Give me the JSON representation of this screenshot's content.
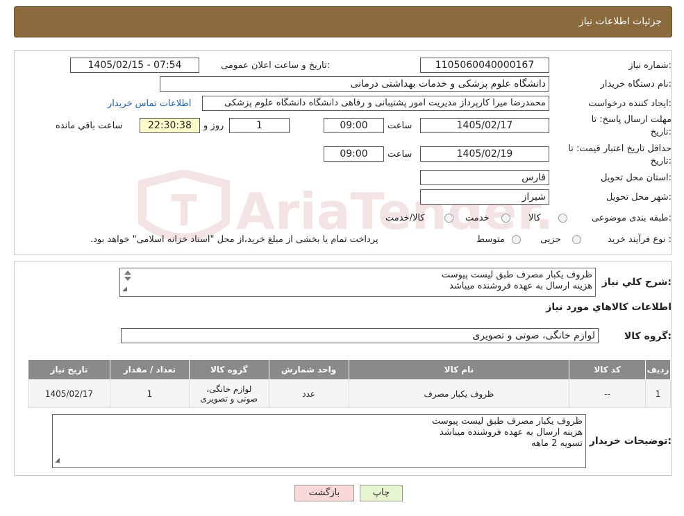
{
  "header": {
    "title": "جزئیات اطلاعات نیاز"
  },
  "fields": {
    "need_number_label": "شماره نیاز:",
    "need_number": "1105060040000167",
    "announce_label": "تاریخ و ساعت اعلان عمومی:",
    "announce_value": "1405/02/15 - 07:54",
    "buyer_org_label": "نام دستگاه خریدار:",
    "buyer_org": "دانشگاه علوم پزشکی و خدمات بهداشتی درمانی",
    "creator_label": "ایجاد کننده درخواست:",
    "creator": "محمدرضا میرا کارپرداز مدیریت امور پشتیبانی و رفاهی دانشگاه دانشگاه علوم پزشکی",
    "contact_link": "اطلاعات تماس خریدار",
    "deadline_label_1": "مهلت ارسال پاسخ: تا",
    "deadline_label_2": "تاریخ:",
    "deadline_date": "1405/02/17",
    "time_label": "ساعت",
    "deadline_time": "09:00",
    "days_value": "1",
    "days_label": "روز و",
    "remaining_time": "22:30:38",
    "remaining_label": "ساعت باقي مانده",
    "validity_label_1": "حداقل تاریخ اعتبار قیمت: تا",
    "validity_label_2": "تاریخ:",
    "validity_date": "1405/02/19",
    "validity_time_label": "ساعت",
    "validity_time": "09:00",
    "province_label": "استان محل تحویل:",
    "province": "فارس",
    "city_label": "شهر محل تحویل:",
    "city": "شیراز",
    "category_label": "طبقه بندی موضوعی:",
    "category_options": [
      "کالا",
      "خدمت",
      "کالا/خدمت"
    ],
    "process_label": "نوع فرآیند خرید :",
    "process_options": [
      "جزیی",
      "متوسط"
    ],
    "process_note": "پرداخت تمام یا بخشی از مبلغ خرید،از محل \"اسناد خزانه اسلامی\" خواهد بود."
  },
  "description": {
    "label": "شرح کلي نياز:",
    "lines": [
      "ظروف یکبار مصرف طبق لیست پیوست",
      "هزینه ارسال به عهده فروشنده میباشد"
    ]
  },
  "goods": {
    "section_title": "اطلاعات کالاهاي مورد نياز",
    "group_label": "گروه کالا:",
    "group_value": "لوازم خانگی، صوتی و تصویری"
  },
  "table": {
    "headers": [
      "رديف",
      "کد کالا",
      "نام کالا",
      "واحد شمارش",
      "گروه کالا",
      "تعداد / مقدار",
      "تاريخ نياز"
    ],
    "rows": [
      {
        "row": "1",
        "code": "--",
        "name": "ظروف یکبار مصرف",
        "unit": "عدد",
        "group_1": "لوازم خانگی،",
        "group_2": "صوتی و تصویری",
        "qty": "1",
        "date": "1405/02/17"
      }
    ]
  },
  "buyer_notes": {
    "label": "توضیحات خریدار:",
    "lines": [
      "ظروف یکبار مصرف طبق لیست پیوست",
      "هزینه ارسال به عهده فروشنده میباشد",
      "تسویه 2 ماهه"
    ]
  },
  "buttons": {
    "print": "چاپ",
    "back": "بازگشت"
  },
  "watermark": {
    "text": "AriaTender.neT"
  },
  "colors": {
    "header_bg": "#8b6a3e",
    "table_header_bg": "#8a8a8a",
    "link": "#1a5fb4",
    "print_btn_bg": "#e6f5d0",
    "back_btn_bg": "#f8d8d8",
    "remaining_bg": "#ffffcc"
  }
}
